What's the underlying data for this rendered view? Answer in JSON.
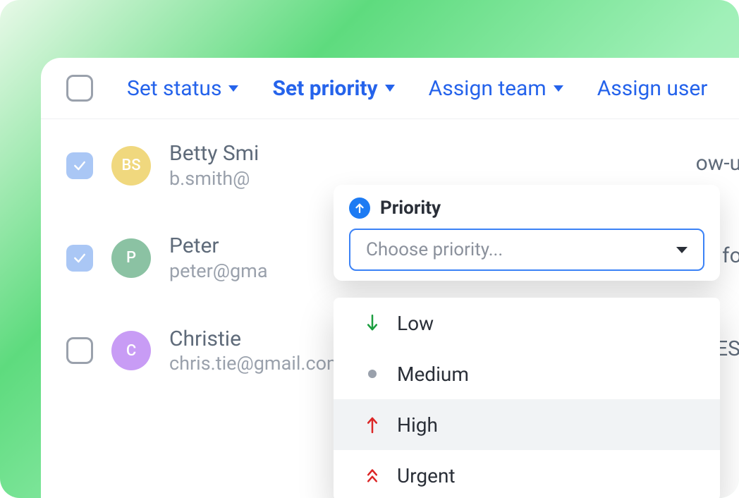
{
  "toolbar": {
    "actions": [
      {
        "label": "Set status",
        "active": false
      },
      {
        "label": "Set priority",
        "active": true
      },
      {
        "label": "Assign team",
        "active": false
      },
      {
        "label": "Assign user",
        "active": false
      }
    ]
  },
  "rows": [
    {
      "checked": true,
      "initials": "BS",
      "avatar_color": "#f0d87e",
      "name": "Betty Smi",
      "email": "b.smith@",
      "tail": "ow-up"
    },
    {
      "checked": true,
      "initials": "P",
      "avatar_color": "#8bc2a3",
      "name": "Peter",
      "email": "peter@gma",
      "tail": "ion for."
    },
    {
      "checked": false,
      "initials": "C",
      "avatar_color": "#c89cf5",
      "name": "Christie",
      "email": "chris.tie@gmail.com",
      "tail": "SSUES}."
    }
  ],
  "priority": {
    "title": "Priority",
    "placeholder": "Choose priority...",
    "options": [
      {
        "label": "Low",
        "icon": "arrow-down",
        "color": "#1b9e3f",
        "hovered": false
      },
      {
        "label": "Medium",
        "icon": "dot",
        "color": "#9aa1ac",
        "hovered": false
      },
      {
        "label": "High",
        "icon": "arrow-up",
        "color": "#dc2626",
        "hovered": true
      },
      {
        "label": "Urgent",
        "icon": "double-up",
        "color": "#dc2626",
        "hovered": false
      }
    ]
  }
}
